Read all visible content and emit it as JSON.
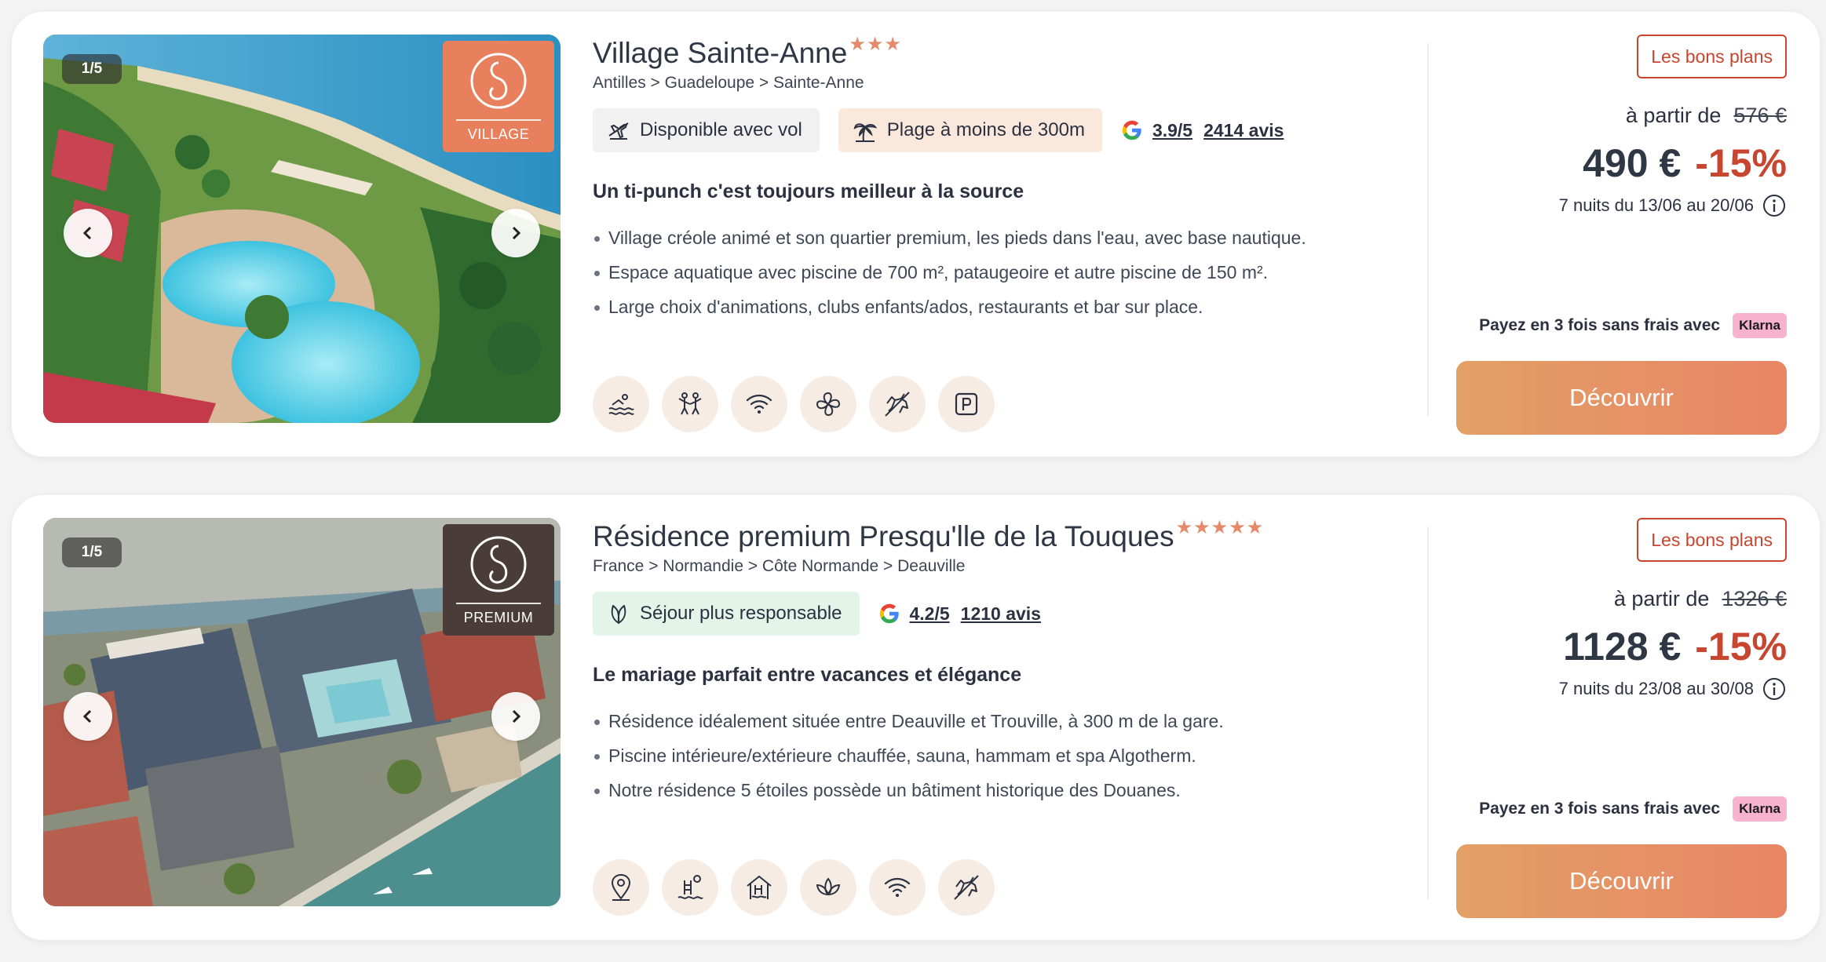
{
  "colors": {
    "accent": "#c8452f",
    "cta_gradient_start": "#e3a065",
    "cta_gradient_end": "#e88566",
    "village_badge": "#e8805d",
    "premium_badge": "#4a3c38",
    "klarna_pink": "#f7b2cd",
    "stars": "#e58a6a"
  },
  "listings": [
    {
      "photo_counter": "1/5",
      "badge_label": "VILLAGE",
      "badge_style": "village",
      "title": "Village Sainte-Anne",
      "stars": "★★★",
      "breadcrumb": "Antilles > Guadeloupe > Sainte-Anne",
      "tags": [
        {
          "icon": "plane-icon",
          "label": "Disponible avec vol",
          "style": "grey"
        },
        {
          "icon": "palm-tree-icon",
          "label": "Plage à moins de 300m",
          "style": "peach"
        }
      ],
      "rating": {
        "icon": "google-icon",
        "score": "3.9/5",
        "reviews": "2414 avis"
      },
      "headline": "Un ti-punch c'est toujours meilleur à la source",
      "bullets": [
        "Village créole animé et son quartier premium, les pieds dans l'eau, avec base nautique.",
        "Espace aquatique avec piscine de 700 m², pataugeoire et autre piscine de 150 m².",
        "Large choix d'animations, clubs enfants/ados, restaurants et bar sur place."
      ],
      "amenities": [
        "swimming-icon",
        "kids-club-icon",
        "wifi-icon",
        "air-conditioning-icon",
        "pets-allowed-icon",
        "parking-icon"
      ],
      "deal_label": "Les bons plans",
      "from_label": "à partir de",
      "old_price": "576 €",
      "price": "490 €",
      "discount": "-15%",
      "dates": "7 nuits du 13/06 au 20/06",
      "klarna_text": "Payez en 3 fois sans frais avec",
      "klarna_badge": "Klarna",
      "cta_label": "Découvrir"
    },
    {
      "photo_counter": "1/5",
      "badge_label": "PREMIUM",
      "badge_style": "premium",
      "title": "Résidence premium Presqu'lle de la Touques",
      "stars": "★★★★★",
      "breadcrumb": "France > Normandie > Côte Normande > Deauville",
      "tags": [
        {
          "icon": "leaf-icon",
          "label": "Séjour plus responsable",
          "style": "green"
        }
      ],
      "rating": {
        "icon": "google-icon",
        "score": "4.2/5",
        "reviews": "1210 avis"
      },
      "headline": "Le mariage parfait entre vacances et élégance",
      "bullets": [
        "Résidence idéalement située entre Deauville et Trouville, à 300 m de la gare.",
        "Piscine intérieure/extérieure chauffée, sauna, hammam et spa Algotherm.",
        "Notre résidence 5 étoiles possède un bâtiment historique des Douanes."
      ],
      "amenities": [
        "location-pin-icon",
        "outdoor-pool-icon",
        "indoor-pool-icon",
        "spa-icon",
        "wifi-icon",
        "pets-allowed-icon"
      ],
      "deal_label": "Les bons plans",
      "from_label": "à partir de",
      "old_price": "1326 €",
      "price": "1128 €",
      "discount": "-15%",
      "dates": "7 nuits du 23/08 au 30/08",
      "klarna_text": "Payez en 3 fois sans frais avec",
      "klarna_badge": "Klarna",
      "cta_label": "Découvrir"
    }
  ]
}
